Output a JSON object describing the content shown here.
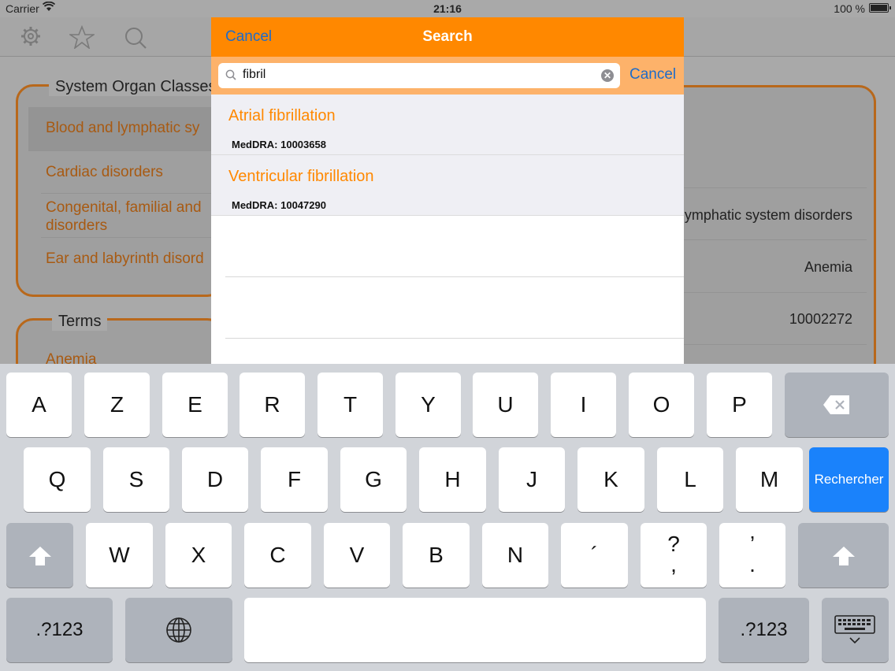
{
  "status_bar": {
    "carrier": "Carrier",
    "time": "21:16",
    "battery": "100 %"
  },
  "background": {
    "soc_panel": {
      "title": "System Organ Classes",
      "items": [
        "Blood and lymphatic sy",
        "Cardiac disorders",
        "Congenital, familial and",
        "disorders",
        "Ear and labyrinth disord"
      ]
    },
    "terms_panel": {
      "title": "Terms",
      "items": [
        "Anemia"
      ]
    },
    "detail": {
      "values": [
        "ymphatic system disorders",
        "Anemia",
        "10002272"
      ]
    }
  },
  "popover": {
    "nav": {
      "cancel_label": "Cancel",
      "title": "Search"
    },
    "search": {
      "value": "fibril",
      "cancel_label": "Cancel"
    },
    "results": [
      {
        "title": "Atrial fibrillation",
        "code": "MedDRA: 10003658"
      },
      {
        "title": "Ventricular fibrillation",
        "code": "MedDRA: 10047290"
      }
    ]
  },
  "keyboard": {
    "row1": [
      "A",
      "Z",
      "E",
      "R",
      "T",
      "Y",
      "U",
      "I",
      "O",
      "P"
    ],
    "row2": [
      "Q",
      "S",
      "D",
      "F",
      "G",
      "H",
      "J",
      "K",
      "L",
      "M"
    ],
    "row3": [
      "W",
      "X",
      "C",
      "V",
      "B",
      "N",
      "´"
    ],
    "punct": [
      [
        "?",
        ","
      ],
      [
        "’",
        "."
      ]
    ],
    "search_key": "Rechercher",
    "numbers_key": ".?123",
    "icons": [
      "backspace-icon",
      "shift-icon",
      "globe-icon",
      "keyboard-dismiss-icon"
    ]
  }
}
